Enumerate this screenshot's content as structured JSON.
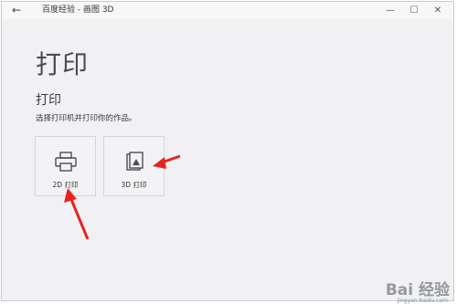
{
  "window": {
    "title": "百度经验 - 画图 3D",
    "back_glyph": "←",
    "min_glyph": "—",
    "max_glyph": "☐",
    "close_glyph": "✕"
  },
  "main": {
    "page_title": "打印",
    "section_title": "打印",
    "section_desc": "选择打印机并打印你的作品。",
    "tiles": [
      {
        "label": "2D 打印",
        "icon": "printer-icon"
      },
      {
        "label": "3D 打印",
        "icon": "3d-print-icon"
      }
    ]
  },
  "annotations": {
    "arrow_color": "#e8241c"
  },
  "watermark": {
    "text": "Bai 经验",
    "sub": "jingyan.baidu.com"
  }
}
